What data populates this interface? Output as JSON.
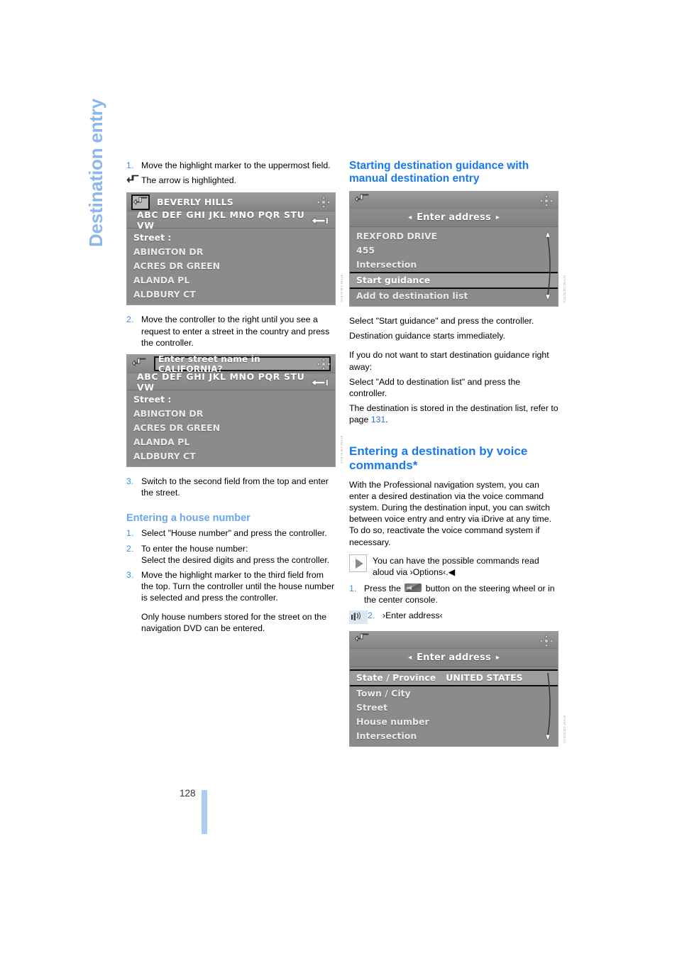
{
  "chapter": {
    "title": "Destination entry"
  },
  "page": {
    "number": "128"
  },
  "left_column": {
    "step1": {
      "num": "1.",
      "text": "Move the highlight marker to the uppermost field."
    },
    "step1_note": {
      "text": "The arrow is highlighted.",
      "icon": "back-arrow-icon"
    },
    "screen1": {
      "name": "street-list-beverly-hills",
      "title": "BEVERLY HILLS",
      "alphabet": "ABC DEF GHI JKL MNO PQR STU VW",
      "rows": [
        "Street :",
        "ABINGTON DR",
        "ACRES DR GREEN",
        "ALANDA PL",
        "ALDBURY CT"
      ],
      "watermark": "VC570JETJNAJK"
    },
    "step2": {
      "num": "2.",
      "text": "Move the controller to the right until you see a request to enter a street in the country and press the controller."
    },
    "screen2": {
      "name": "street-name-entry-california",
      "title": "Enter street name in CALIFORNIA?",
      "alphabet": "ABC DEF GHI JKL MNO PQR STU VW",
      "rows": [
        "Street :",
        "ABINGTON DR",
        "ACRES DR GREEN",
        "ALANDA PL",
        "ALDBURY CT"
      ],
      "watermark": "VC570JETJNAJK"
    },
    "step3": {
      "num": "3.",
      "text": "Switch to the second field from the top and enter the street."
    },
    "house_number": {
      "heading": "Entering a house number",
      "steps": [
        {
          "num": "1.",
          "text": "Select \"House number\" and press the controller."
        },
        {
          "num": "2.",
          "text": "To enter the house number:"
        },
        {
          "num": "",
          "text": "Select the desired digits and press the controller."
        },
        {
          "num": "3.",
          "text": "Move the highlight marker to the third field from the top. Turn the controller until the house number is selected and press the controller."
        }
      ],
      "note": "Only house numbers stored for the street on the navigation DVD can be entered."
    }
  },
  "right_column": {
    "heading1": "Starting destination guidance with manual destination entry",
    "screen3": {
      "name": "enter-address-start-guidance",
      "banner": "Enter address",
      "rows": [
        {
          "label": "REXFORD DRIVE",
          "selected": false
        },
        {
          "label": "455",
          "selected": false
        },
        {
          "label": "Intersection",
          "selected": false
        },
        {
          "label": "Start guidance",
          "selected": true
        },
        {
          "label": "Add to destination list",
          "selected": false
        }
      ],
      "watermark": "VC570JETJNAJK"
    },
    "para1": "Select \"Start guidance\" and press the controller.",
    "para2": "Destination guidance starts immediately.",
    "para3": "If you do not want to start destination guidance right away:",
    "para4": "Select \"Add to destination list\" and press the controller.",
    "para5_a": "The destination is stored in the destination list, refer to page ",
    "para5_ref": "131",
    "para5_b": ".",
    "heading2": "Entering a destination by voice commands*",
    "para6": "With the Professional navigation system, you can enter a desired destination via the voice command system. During the destination input, you can switch between voice entry and entry via iDrive at any time. To do so, reactivate the voice command system if necessary.",
    "note1": "You can have the possible commands read aloud via ›Options‹.◀",
    "voice_step1": {
      "num": "1.",
      "text_before": "Press the ",
      "text_after": " button on the steering wheel or in the center console."
    },
    "voice_step2": {
      "num": "2.",
      "text": "›Enter address‹"
    },
    "screen4": {
      "name": "enter-address-fields",
      "banner": "Enter address",
      "rows": [
        {
          "label": "State / Province",
          "value": "UNITED STATES",
          "selected": true
        },
        {
          "label": "Town / City",
          "value": "",
          "selected": false
        },
        {
          "label": "Street",
          "value": "",
          "selected": false
        },
        {
          "label": "House number",
          "value": "",
          "selected": false
        },
        {
          "label": "Intersection",
          "value": "",
          "selected": false
        }
      ],
      "watermark": "VC570JETJNAJK"
    }
  },
  "colors": {
    "heading_blue": "#1a78f0",
    "subhead_blue": "#6aa6ee",
    "chapter_blue": "#8cb7ea",
    "number_blue": "#3a8ef0",
    "page_marker": "#aecbf2",
    "screen_gray": "#8b8b8b"
  }
}
